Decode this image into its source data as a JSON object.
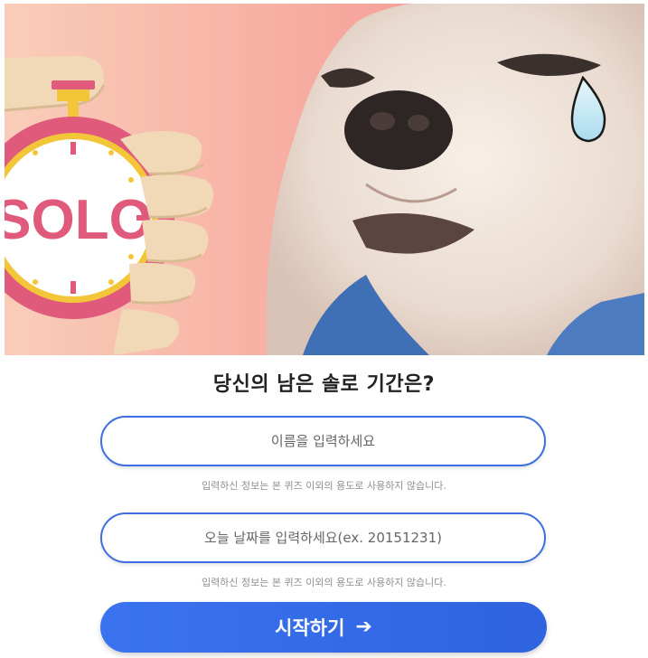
{
  "hero": {
    "stopwatch_text": "SOLO",
    "colors": {
      "background_left": "#f8c9b5",
      "background_right": "#f48d8d",
      "stopwatch_ring": "#e05a7c",
      "stopwatch_rim": "#f3c63a",
      "dog_fur": "#f1e6dc",
      "tear": "#bfe6f2"
    }
  },
  "quiz": {
    "title": "당신의 남은 솔로 기간은?",
    "name_input": {
      "placeholder": "이름을 입력하세요",
      "value": ""
    },
    "name_notice": "입력하신 정보는 본 퀴즈 이외의 용도로 사용하지 않습니다.",
    "date_input": {
      "placeholder": "오늘 날짜를 입력하세요(ex. 20151231)",
      "value": ""
    },
    "date_notice": "입력하신 정보는 본 퀴즈 이외의 용도로 사용하지 않습니다.",
    "start_button": {
      "label": "시작하기",
      "icon": "arrow-right-icon",
      "icon_glyph": "➔"
    }
  },
  "colors": {
    "accent": "#3d6fe0",
    "button": "#3a73f0",
    "notice_text": "#8f8f8f",
    "title_text": "#222222"
  }
}
